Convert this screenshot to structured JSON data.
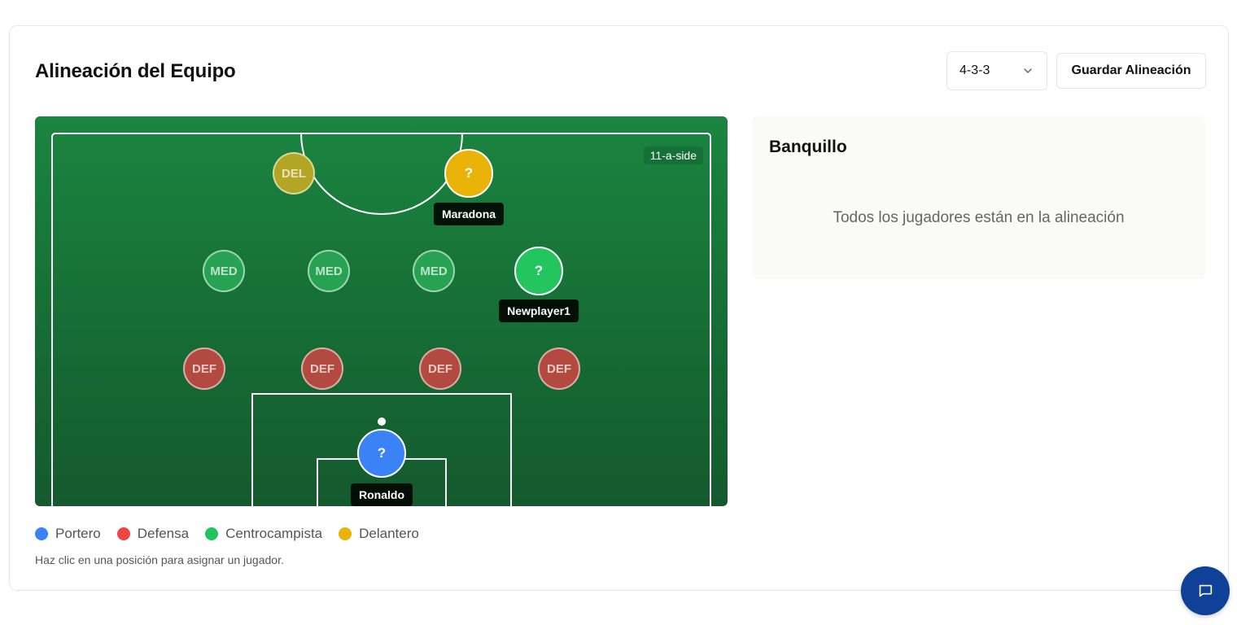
{
  "header": {
    "title": "Alineación del Equipo",
    "formation_value": "4-3-3",
    "save_label": "Guardar Alineación"
  },
  "pitch": {
    "badge": "11-a-side",
    "slots": {
      "fwd_left": "DEL",
      "fwd_right": "?",
      "mid_1": "MED",
      "mid_2": "MED",
      "mid_3": "MED",
      "mid_4": "?",
      "def_1": "DEF",
      "def_2": "DEF",
      "def_3": "DEF",
      "def_4": "DEF",
      "gk": "?"
    },
    "players": {
      "fwd_right": "Maradona",
      "mid_4": "Newplayer1",
      "gk": "Ronaldo"
    }
  },
  "legend": [
    {
      "label": "Portero",
      "color": "#3b82f6"
    },
    {
      "label": "Defensa",
      "color": "#ef4444"
    },
    {
      "label": "Centrocampista",
      "color": "#22c55e"
    },
    {
      "label": "Delantero",
      "color": "#eab308"
    }
  ],
  "hint": "Haz clic en una posición para asignar un jugador.",
  "bench": {
    "title": "Banquillo",
    "empty_message": "Todos los jugadores están en la alineación"
  },
  "icons": {
    "formation_chevron": "chevron-down-icon",
    "chat": "chat-icon"
  }
}
